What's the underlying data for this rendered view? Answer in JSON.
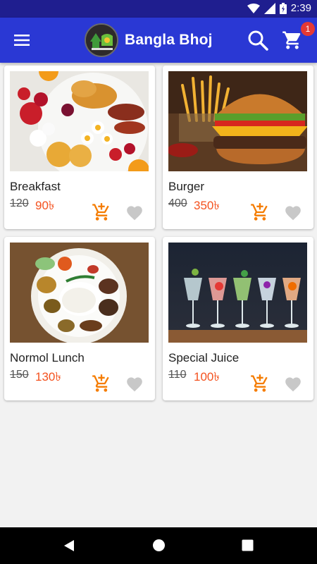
{
  "status_bar": {
    "time": "2:39"
  },
  "app_bar": {
    "title": "Bangla Bhoj",
    "cart_count": "1"
  },
  "products": [
    {
      "name": "Breakfast",
      "old_price": "120",
      "new_price": "90৳",
      "image": "breakfast-photo"
    },
    {
      "name": "Burger",
      "old_price": "400",
      "new_price": "350৳",
      "image": "burger-photo"
    },
    {
      "name": "Normol Lunch",
      "old_price": "150",
      "new_price": "130৳",
      "image": "lunch-photo"
    },
    {
      "name": "Special Juice",
      "old_price": "110",
      "new_price": "100৳",
      "image": "juice-photo"
    }
  ],
  "colors": {
    "status_bar": "#1f1e8f",
    "app_bar": "#2a38d4",
    "price": "#f4511e",
    "cart_icon": "#f57c00",
    "badge": "#e53935"
  }
}
